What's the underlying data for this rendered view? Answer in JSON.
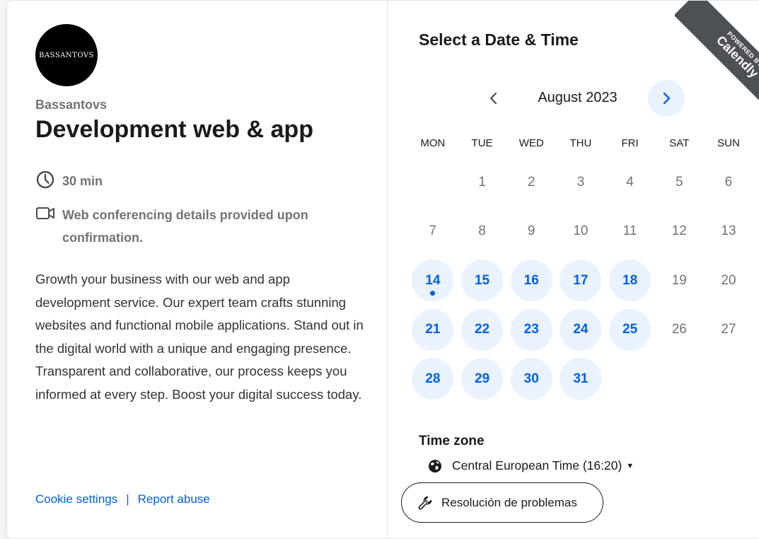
{
  "event": {
    "logo_text": "BASSANTOVS",
    "organizer": "Bassantovs",
    "title": "Development web & app",
    "duration": "30 min",
    "conferencing": "Web conferencing details provided upon confirmation.",
    "description": "Growth your business with our web and app development service. Our expert team crafts stunning websites and functional mobile applications. Stand out in the digital world with a unique and engaging presence. Transparent and collaborative, our process keeps you informed at every step. Boost your digital success today."
  },
  "footer": {
    "cookie_label": "Cookie settings",
    "separator": "|",
    "report_label": "Report abuse"
  },
  "calendar": {
    "heading": "Select a Date & Time",
    "month_label": "August 2023",
    "weekdays": [
      "MON",
      "TUE",
      "WED",
      "THU",
      "FRI",
      "SAT",
      "SUN"
    ],
    "leading_blanks": 1,
    "days": [
      {
        "n": "1",
        "available": false
      },
      {
        "n": "2",
        "available": false
      },
      {
        "n": "3",
        "available": false
      },
      {
        "n": "4",
        "available": false
      },
      {
        "n": "5",
        "available": false
      },
      {
        "n": "6",
        "available": false
      },
      {
        "n": "7",
        "available": false
      },
      {
        "n": "8",
        "available": false
      },
      {
        "n": "9",
        "available": false
      },
      {
        "n": "10",
        "available": false
      },
      {
        "n": "11",
        "available": false
      },
      {
        "n": "12",
        "available": false
      },
      {
        "n": "13",
        "available": false
      },
      {
        "n": "14",
        "available": true,
        "today": true
      },
      {
        "n": "15",
        "available": true
      },
      {
        "n": "16",
        "available": true
      },
      {
        "n": "17",
        "available": true
      },
      {
        "n": "18",
        "available": true
      },
      {
        "n": "19",
        "available": false
      },
      {
        "n": "20",
        "available": false
      },
      {
        "n": "21",
        "available": true
      },
      {
        "n": "22",
        "available": true
      },
      {
        "n": "23",
        "available": true
      },
      {
        "n": "24",
        "available": true
      },
      {
        "n": "25",
        "available": true
      },
      {
        "n": "26",
        "available": false
      },
      {
        "n": "27",
        "available": false
      },
      {
        "n": "28",
        "available": true
      },
      {
        "n": "29",
        "available": true
      },
      {
        "n": "30",
        "available": true
      },
      {
        "n": "31",
        "available": true
      }
    ]
  },
  "timezone": {
    "title": "Time zone",
    "value": "Central European Time (16:20)"
  },
  "troubleshoot": {
    "label": "Resolución de problemas"
  },
  "badge": {
    "small": "POWERED BY",
    "big": "Calendly"
  },
  "colors": {
    "accent": "#0060e6",
    "available_bg": "#e9f2fd",
    "ribbon": "#4d5055"
  }
}
